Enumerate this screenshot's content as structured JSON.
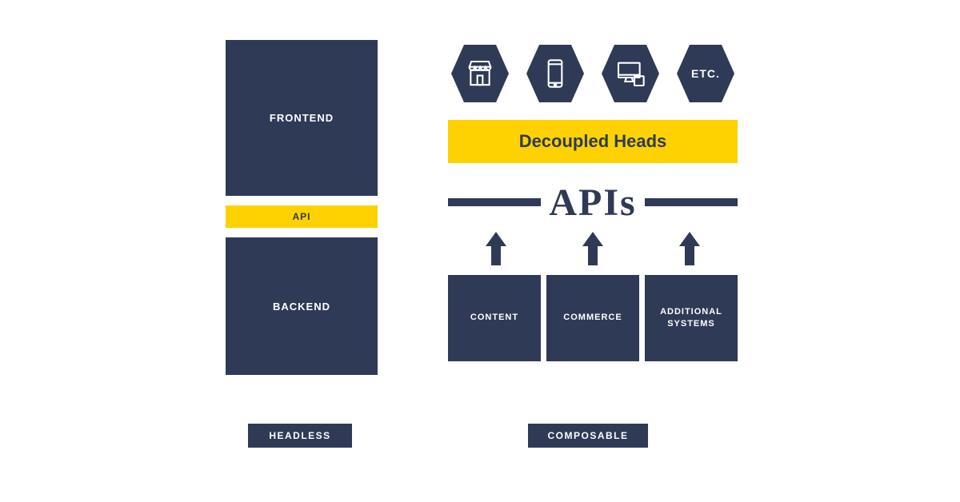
{
  "colors": {
    "navy": "#2f3a56",
    "yellow": "#fdd200"
  },
  "left": {
    "frontend": "FRONTEND",
    "api": "API",
    "backend": "BACKEND",
    "caption": "HEADLESS"
  },
  "right": {
    "heads": [
      {
        "name": "storefront-icon",
        "label": ""
      },
      {
        "name": "mobile-icon",
        "label": ""
      },
      {
        "name": "desktop-icon",
        "label": ""
      },
      {
        "name": "etc-label",
        "label": "ETC."
      }
    ],
    "decoupled": "Decoupled Heads",
    "apis": "APIs",
    "services": [
      "CONTENT",
      "COMMERCE",
      "ADDITIONAL SYSTEMS"
    ],
    "caption": "COMPOSABLE"
  }
}
